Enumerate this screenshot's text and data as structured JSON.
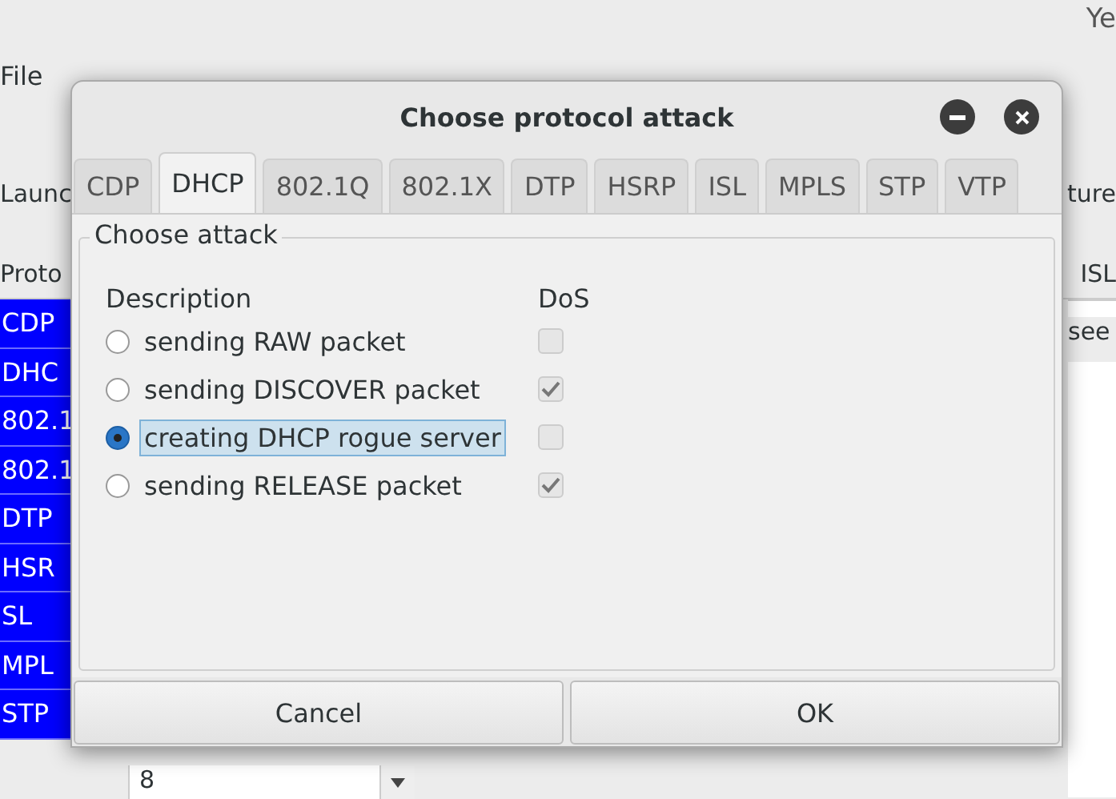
{
  "background_app": {
    "top_text": "Ye",
    "menu": [
      "File"
    ],
    "toolbar_left": "Launc",
    "toolbar_right": "ture",
    "table_header_left": "Proto",
    "table_header_right": "ISL",
    "right_cell": "see",
    "protocol_list": [
      {
        "label": "CDP"
      },
      {
        "label": "DHC"
      },
      {
        "label": "802.1"
      },
      {
        "label": "802.1"
      },
      {
        "label": "DTP"
      },
      {
        "label": "HSR"
      },
      {
        "label": "SL"
      },
      {
        "label": "MPL"
      },
      {
        "label": "STP"
      }
    ],
    "bottom_value": "8"
  },
  "dialog": {
    "title": "Choose protocol attack",
    "tabs": [
      {
        "label": "CDP",
        "selected": false
      },
      {
        "label": "DHCP",
        "selected": true
      },
      {
        "label": "802.1Q",
        "selected": false
      },
      {
        "label": "802.1X",
        "selected": false
      },
      {
        "label": "DTP",
        "selected": false
      },
      {
        "label": "HSRP",
        "selected": false
      },
      {
        "label": "ISL",
        "selected": false
      },
      {
        "label": "MPLS",
        "selected": false
      },
      {
        "label": "STP",
        "selected": false
      },
      {
        "label": "VTP",
        "selected": false
      }
    ],
    "group_title": "Choose attack",
    "columns": [
      "Description",
      "DoS"
    ],
    "attacks": [
      {
        "label": "sending RAW packet",
        "selected": false,
        "dos": false
      },
      {
        "label": "sending DISCOVER packet",
        "selected": false,
        "dos": true
      },
      {
        "label": "creating DHCP rogue server",
        "selected": true,
        "dos": false
      },
      {
        "label": "sending RELEASE packet",
        "selected": false,
        "dos": true
      }
    ],
    "buttons": [
      "Cancel",
      "OK"
    ]
  }
}
